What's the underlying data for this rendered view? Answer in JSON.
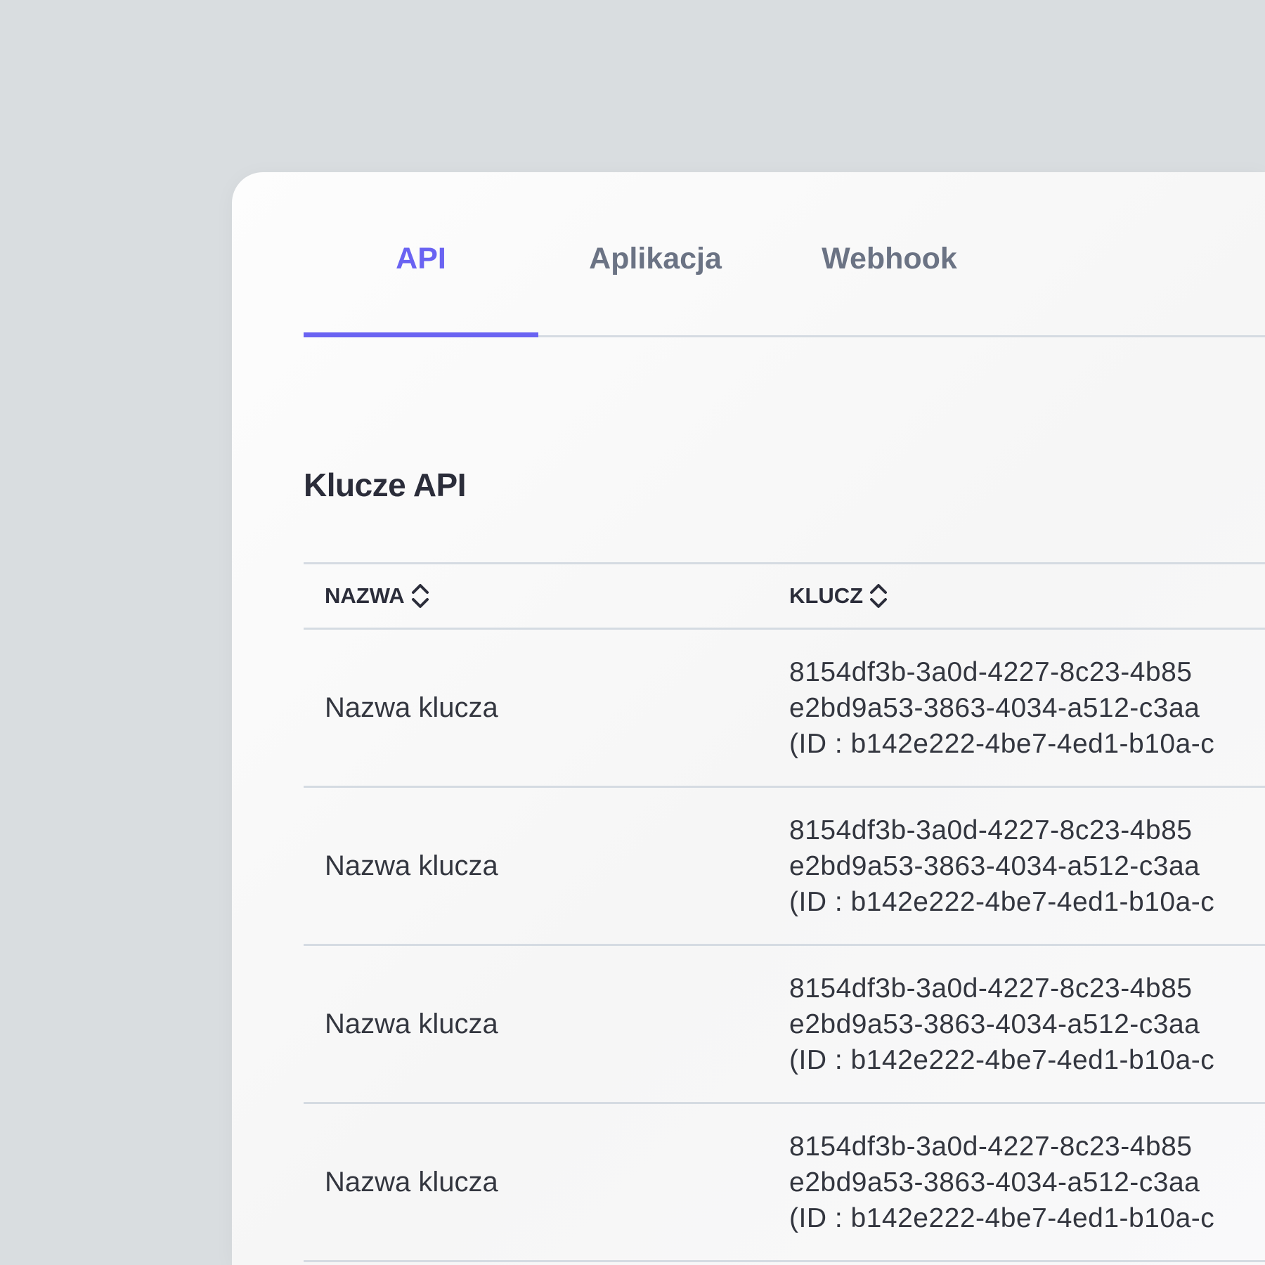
{
  "tabs": [
    {
      "label": "API",
      "active": true
    },
    {
      "label": "Aplikacja",
      "active": false
    },
    {
      "label": "Webhook",
      "active": false
    }
  ],
  "section": {
    "title": "Klucze API"
  },
  "table": {
    "columns": [
      {
        "label": "NAZWA",
        "sort_icon": "sort-icon"
      },
      {
        "label": "KLUCZ",
        "sort_icon": "sort-icon"
      }
    ],
    "rows": [
      {
        "name": "Nazwa klucza",
        "key_line1": "8154df3b-3a0d-4227-8c23-4b85",
        "key_line2": "e2bd9a53-3863-4034-a512-c3aa",
        "key_line3": "(ID : b142e222-4be7-4ed1-b10a-c"
      },
      {
        "name": "Nazwa klucza",
        "key_line1": "8154df3b-3a0d-4227-8c23-4b85",
        "key_line2": "e2bd9a53-3863-4034-a512-c3aa",
        "key_line3": "(ID : b142e222-4be7-4ed1-b10a-c"
      },
      {
        "name": "Nazwa klucza",
        "key_line1": "8154df3b-3a0d-4227-8c23-4b85",
        "key_line2": "e2bd9a53-3863-4034-a512-c3aa",
        "key_line3": "(ID : b142e222-4be7-4ed1-b10a-c"
      },
      {
        "name": "Nazwa klucza",
        "key_line1": "8154df3b-3a0d-4227-8c23-4b85",
        "key_line2": "e2bd9a53-3863-4034-a512-c3aa",
        "key_line3": "(ID : b142e222-4be7-4ed1-b10a-c"
      }
    ]
  },
  "colors": {
    "accent": "#6a63f2",
    "background": "#d9dde0",
    "panel": "#f8f8f8",
    "divider": "#d5dbe2",
    "text": "#33363f",
    "tab_inactive": "#6b7384"
  }
}
